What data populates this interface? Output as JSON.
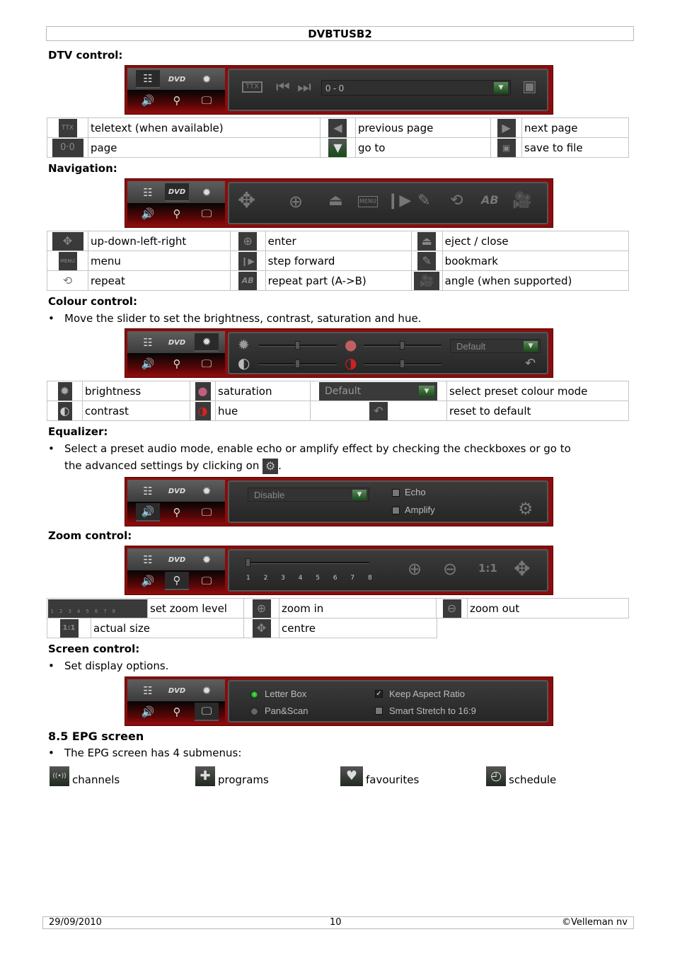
{
  "header": {
    "title": "DVBTUSB2"
  },
  "player_tabs": {
    "tab_icons": [
      "list-icon",
      "dvd-icon",
      "brightness-icon",
      "speaker-icon",
      "magnifier-icon",
      "monitor-icon"
    ],
    "dvd_label": "DVD"
  },
  "dtv": {
    "heading": "DTV control:",
    "page_field": "0 - 0",
    "ttx_label": "TTX",
    "legend": [
      [
        {
          "icon": "TTX",
          "label": "teletext (when available)"
        },
        {
          "icon": "◀",
          "label": "previous page"
        },
        {
          "icon": "▶",
          "label": "next page"
        }
      ],
      [
        {
          "icon": "0·0",
          "label": "page"
        },
        {
          "icon": "▼",
          "label": "go to"
        },
        {
          "icon": "💾",
          "label": "save to file"
        }
      ]
    ]
  },
  "navigation": {
    "heading": "Navigation:",
    "menu_label": "MENU",
    "ab_label": "AB",
    "legend": [
      [
        {
          "icon": "✥",
          "label": "up-down-left-right"
        },
        {
          "icon": "⊕",
          "label": "enter"
        },
        {
          "icon": "⏏",
          "label": "eject / close"
        }
      ],
      [
        {
          "icon": "MENU",
          "label": "menu"
        },
        {
          "icon": "❙▶",
          "label": "step forward"
        },
        {
          "icon": "✎",
          "label": "bookmark"
        }
      ],
      [
        {
          "icon": "⟲",
          "label": "repeat"
        },
        {
          "icon": "AB",
          "label": "repeat part (A->B)"
        },
        {
          "icon": "🎥",
          "label": "angle (when supported)"
        }
      ]
    ]
  },
  "colour": {
    "heading": "Colour control:",
    "bullet": "Move the slider to set the brightness, contrast, saturation and hue.",
    "preset_value": "Default",
    "sliders": {
      "brightness": 0.5,
      "saturation": 0.5,
      "contrast": 0.5,
      "hue": 0.5
    },
    "legend": [
      [
        {
          "icon": "✹",
          "label": "brightness"
        },
        {
          "icon": "●",
          "label": "saturation"
        },
        {
          "icon": "Default",
          "label": "select preset colour mode"
        }
      ],
      [
        {
          "icon": "◐",
          "label": "contrast"
        },
        {
          "icon": "◑",
          "label": "hue"
        },
        {
          "icon": "↶",
          "label": "reset to default"
        }
      ]
    ]
  },
  "equalizer": {
    "heading": "Equalizer:",
    "bullet_line1": "Select a preset audio mode, enable echo or amplify effect by checking the checkboxes or go to",
    "bullet_line2": "the advanced settings by clicking on",
    "preset_value": "Disable",
    "echo_label": "Echo",
    "amplify_label": "Amplify",
    "echo_checked": false,
    "amplify_checked": false
  },
  "zoom": {
    "heading": "Zoom control:",
    "levels": [
      "1",
      "2",
      "3",
      "4",
      "5",
      "6",
      "7",
      "8"
    ],
    "current_level": 1,
    "actual_size_label": "1:1",
    "legend": [
      [
        {
          "icon": "slider",
          "label": "set zoom level"
        },
        {
          "icon": "⊕",
          "label": "zoom in"
        },
        {
          "icon": "⊖",
          "label": "zoom out"
        }
      ],
      [
        {
          "icon": "1:1",
          "label": "actual size"
        },
        {
          "icon": "✥",
          "label": "centre"
        }
      ]
    ]
  },
  "screen": {
    "heading": "Screen control:",
    "bullet": "Set display options.",
    "letterbox_label": "Letter Box",
    "panscan_label": "Pan&Scan",
    "keep_aspect_label": "Keep Aspect Ratio",
    "smart_stretch_label": "Smart Stretch to 16:9",
    "selected_mode": "Letter Box",
    "keep_aspect_checked": true,
    "smart_stretch_checked": false
  },
  "epg": {
    "heading": "8.5 EPG screen",
    "bullet": "The EPG screen has 4 submenus:",
    "submenus": [
      {
        "icon": "antenna-icon",
        "glyph": "((•))",
        "label": "channels"
      },
      {
        "icon": "puzzle-icon",
        "glyph": "✚",
        "label": "programs"
      },
      {
        "icon": "heart-icon",
        "glyph": "♥",
        "label": "favourites"
      },
      {
        "icon": "clock-icon",
        "glyph": "◴",
        "label": "schedule"
      }
    ]
  },
  "footer": {
    "date": "29/09/2010",
    "page": "10",
    "copyright": "©Velleman nv"
  }
}
